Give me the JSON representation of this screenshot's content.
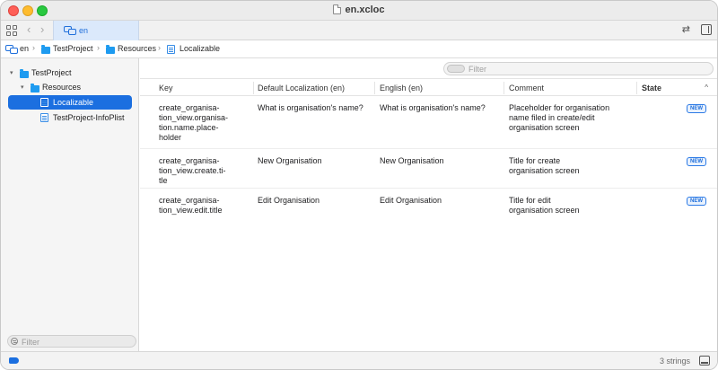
{
  "window": {
    "title": "en.xcloc"
  },
  "tabbar": {
    "tab_label": "en",
    "nav_back": "‹",
    "nav_forward": "›",
    "swap_icon": "⇄"
  },
  "breadcrumb": {
    "items": [
      "en",
      "TestProject",
      "Resources",
      "Localizable"
    ],
    "separator": "›"
  },
  "sidebar": {
    "tree": [
      {
        "label": "TestProject",
        "disclosure": "▾"
      },
      {
        "label": "Resources",
        "disclosure": "▾"
      },
      {
        "label": "Localizable"
      },
      {
        "label": "TestProject-InfoPlist"
      }
    ],
    "filter_placeholder": "Filter"
  },
  "main": {
    "filter_placeholder": "Filter",
    "columns": [
      "Key",
      "Default Localization (en)",
      "English (en)",
      "Comment",
      "State"
    ],
    "sort_indicator": "^",
    "rows": [
      {
        "key": [
          "create_organisa-",
          "tion_view.organisa-",
          "tion.name.place-",
          "holder"
        ],
        "default": "What is organisation's name?",
        "english": "What is organisation's name?",
        "comment": [
          "Placeholder for organisation",
          "name filed in create/edit",
          "organisation screen"
        ],
        "state": "NEW"
      },
      {
        "key": [
          "create_organisa-",
          "tion_view.create.ti-",
          "tle"
        ],
        "default": "New Organisation",
        "english": "New Organisation",
        "comment": [
          "Title for create",
          "organisation screen"
        ],
        "state": "NEW"
      },
      {
        "key": [
          "create_organisa-",
          "tion_view.edit.title"
        ],
        "default": "Edit Organisation",
        "english": "Edit Organisation",
        "comment": [
          "Title for edit",
          "organisation screen"
        ],
        "state": "NEW"
      }
    ]
  },
  "status": {
    "count": "3 strings"
  },
  "colors": {
    "accent": "#1b6fe0",
    "folder": "#1e9bf0",
    "badge_text": "#1f6fdb"
  },
  "icons": {
    "sidebar_toggle": "grid-icon",
    "localization": "localization-icon",
    "folder": "folder-icon",
    "strings_file": "strings-file-icon",
    "inspector": "inspector-icon",
    "swap": "swap-icon",
    "tag": "tag-icon",
    "panel": "panel-icon"
  }
}
